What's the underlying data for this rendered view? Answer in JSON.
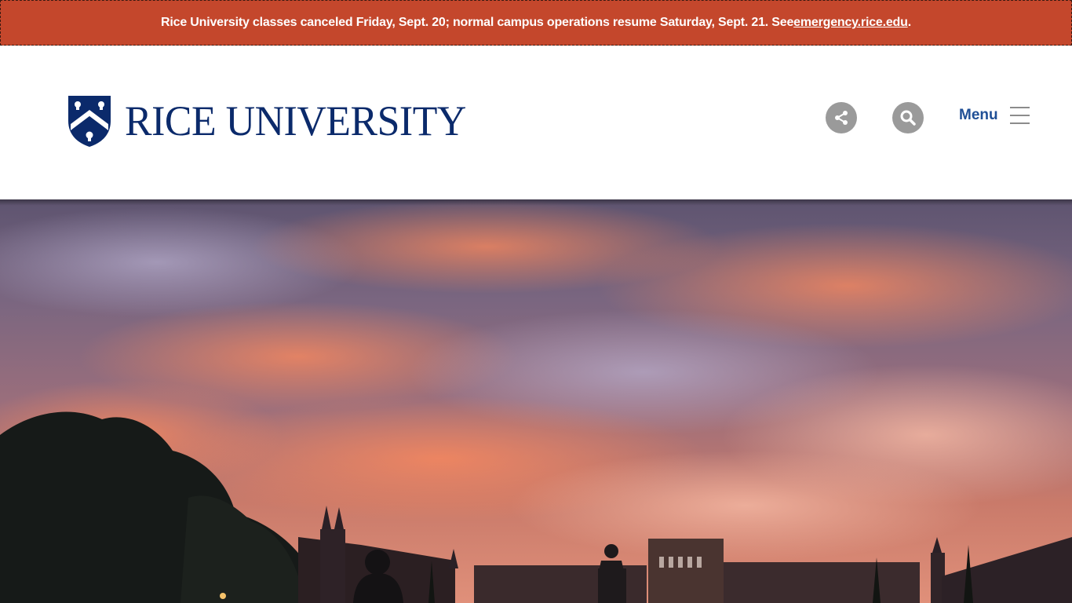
{
  "alert": {
    "text": "Rice University classes canceled Friday, Sept. 20; normal campus operations resume Saturday, Sept. 21. See ",
    "link_text": "emergency.rice.edu",
    "trailing": ".",
    "background": "#c4472c"
  },
  "header": {
    "logo_text": "RICE UNIVERSITY",
    "brand_color": "#0b2a6b",
    "share_icon": "share-icon",
    "search_icon": "search-icon",
    "menu_label": "Menu",
    "menu_icon": "hamburger-icon"
  },
  "hero": {
    "image": "campus-sunset-photo"
  }
}
